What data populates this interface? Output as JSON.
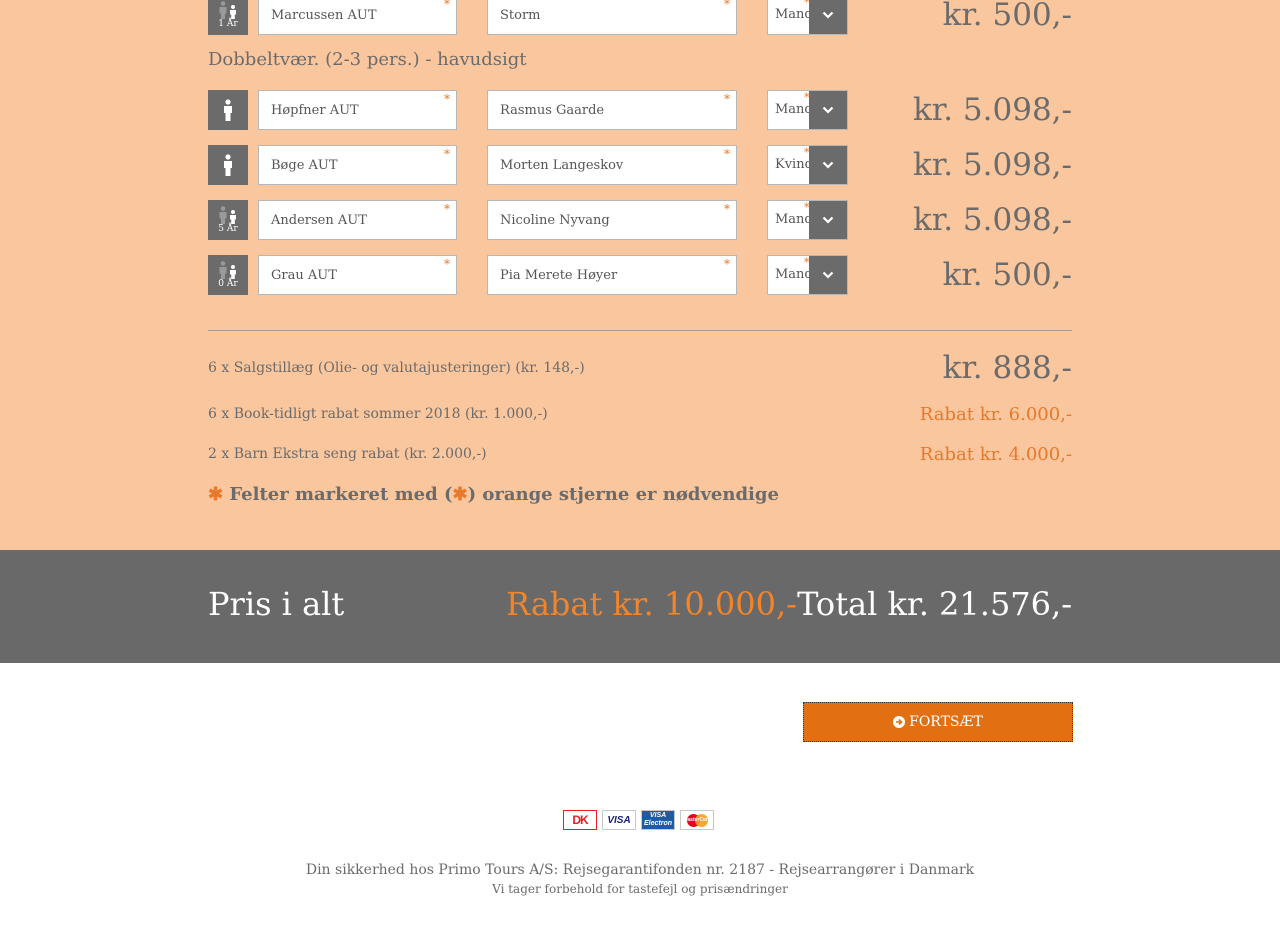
{
  "room_title": "Dobbeltvær. (2-3 pers.) - havudsigt",
  "required_marker": "*",
  "travelers_top": [
    {
      "type": "child",
      "age_label": "1 År",
      "last_name": "Marcussen AUT",
      "first_name": "Storm",
      "gender": "Mand",
      "price": "kr. 500,-"
    }
  ],
  "travelers": [
    {
      "type": "adult",
      "age_label": "",
      "last_name": "Høpfner AUT",
      "first_name": "Rasmus Gaarde",
      "gender": "Mand",
      "price": "kr. 5.098,-"
    },
    {
      "type": "adult",
      "age_label": "",
      "last_name": "Bøge AUT",
      "first_name": "Morten Langeskov",
      "gender": "Kvinde",
      "price": "kr. 5.098,-"
    },
    {
      "type": "child",
      "age_label": "5 År",
      "last_name": "Andersen AUT",
      "first_name": "Nicoline Nyvang",
      "gender": "Mand",
      "price": "kr. 5.098,-"
    },
    {
      "type": "child",
      "age_label": "0 År",
      "last_name": "Grau AUT",
      "first_name": "Pia Merete Høyer",
      "gender": "Mand",
      "price": "kr. 500,-"
    }
  ],
  "extras": [
    {
      "label": "6 x Salgstillæg (Olie- og valutajusteringer) (kr. 148,-)",
      "value": "kr. 888,-",
      "kind": "price"
    },
    {
      "label": "6 x Book-tidligt rabat sommer 2018 (kr. 1.000,-)",
      "value": "Rabat kr. 6.000,-",
      "kind": "discount"
    },
    {
      "label": "2 x Barn Ekstra seng rabat (kr. 2.000,-)",
      "value": "Rabat kr. 4.000,-",
      "kind": "discount"
    }
  ],
  "required_note": {
    "star": "✱",
    "part1": " Felter markeret med (",
    "part2": ") orange stjerne er nødvendige"
  },
  "totals": {
    "label": "Pris i alt",
    "discount": "Rabat kr. 10.000,-",
    "total": "Total kr. 21.576,-"
  },
  "continue_button": "FORTSÆT",
  "payment_cards": [
    "dankort",
    "visa",
    "visa-electron",
    "mastercard"
  ],
  "payment_card_text": {
    "dankort": "DK",
    "visa": "VISA",
    "electron_top": "VISA",
    "electron_bottom": "Electron",
    "mastercard": "MasterCard"
  },
  "footer": {
    "line1": "Din sikkerhed hos Primo Tours A/S: Rejsegarantifonden nr. 2187 - Rejsearrangører i Danmark",
    "line2": "Vi tager forbehold for tastefejl og prisændringer"
  },
  "colors": {
    "peach": "#f9c69d",
    "dark_gray": "#696969",
    "orange": "#e27012",
    "accent_orange": "#e8792b"
  }
}
